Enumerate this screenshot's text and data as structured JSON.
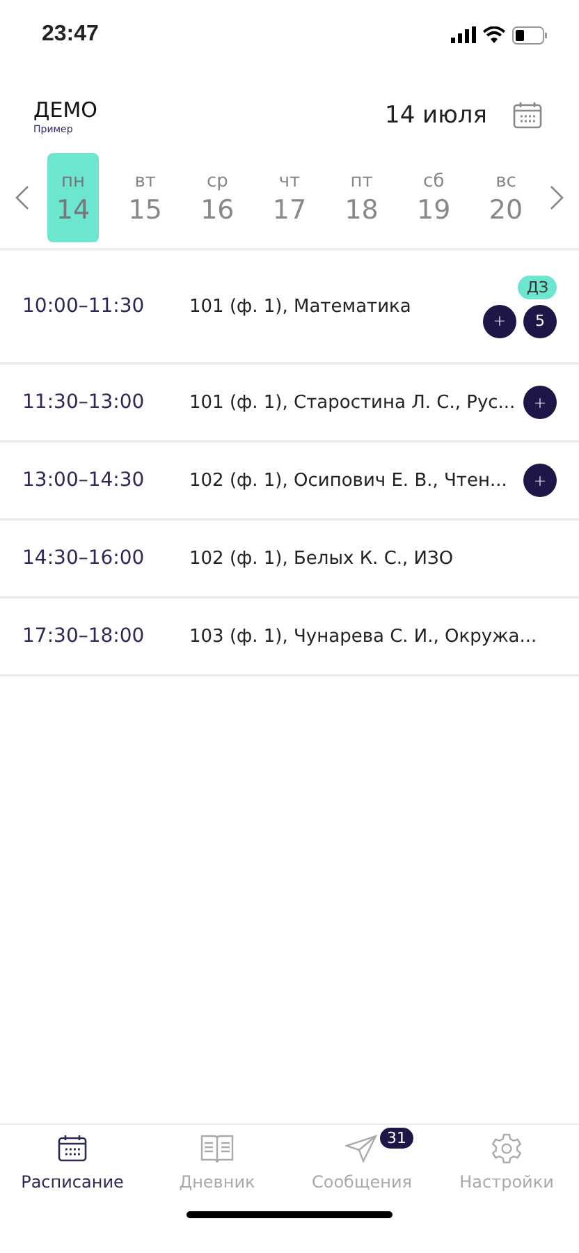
{
  "status_bar": {
    "time": "23:47"
  },
  "header": {
    "title": "ДЕМО",
    "subtitle": "Пример",
    "date": "14 июля"
  },
  "days": [
    {
      "weekday": "пн",
      "day": "14",
      "selected": true
    },
    {
      "weekday": "вт",
      "day": "15",
      "selected": false
    },
    {
      "weekday": "ср",
      "day": "16",
      "selected": false
    },
    {
      "weekday": "чт",
      "day": "17",
      "selected": false
    },
    {
      "weekday": "пт",
      "day": "18",
      "selected": false
    },
    {
      "weekday": "сб",
      "day": "19",
      "selected": false
    },
    {
      "weekday": "вс",
      "day": "20",
      "selected": false
    }
  ],
  "lessons": [
    {
      "time": "10:00–11:30",
      "text": "101 (ф. 1), Математика",
      "badges": [
        {
          "kind": "homework",
          "label": "ДЗ"
        }
      ],
      "actions": [
        {
          "kind": "add",
          "label": "+"
        },
        {
          "kind": "grade",
          "label": "5"
        }
      ]
    },
    {
      "time": "11:30–13:00",
      "text": "101 (ф. 1), Старостина Л. С., Рус...",
      "actions": [
        {
          "kind": "add",
          "label": "+"
        }
      ]
    },
    {
      "time": "13:00–14:30",
      "text": "102 (ф. 1), Осипович Е. В., Чтен...",
      "actions": [
        {
          "kind": "add",
          "label": "+"
        }
      ]
    },
    {
      "time": "14:30–16:00",
      "text": "102 (ф. 1), Белых К. С., ИЗО"
    },
    {
      "time": "17:30–18:00",
      "text": "103 (ф. 1), Чунарева С. И., Окружа..."
    }
  ],
  "tab_bar": [
    {
      "label": "Расписание",
      "selected": true
    },
    {
      "label": "Дневник",
      "selected": false
    },
    {
      "label": "Сообщения",
      "selected": false,
      "badge": "31"
    },
    {
      "label": "Настройки",
      "selected": false
    }
  ]
}
